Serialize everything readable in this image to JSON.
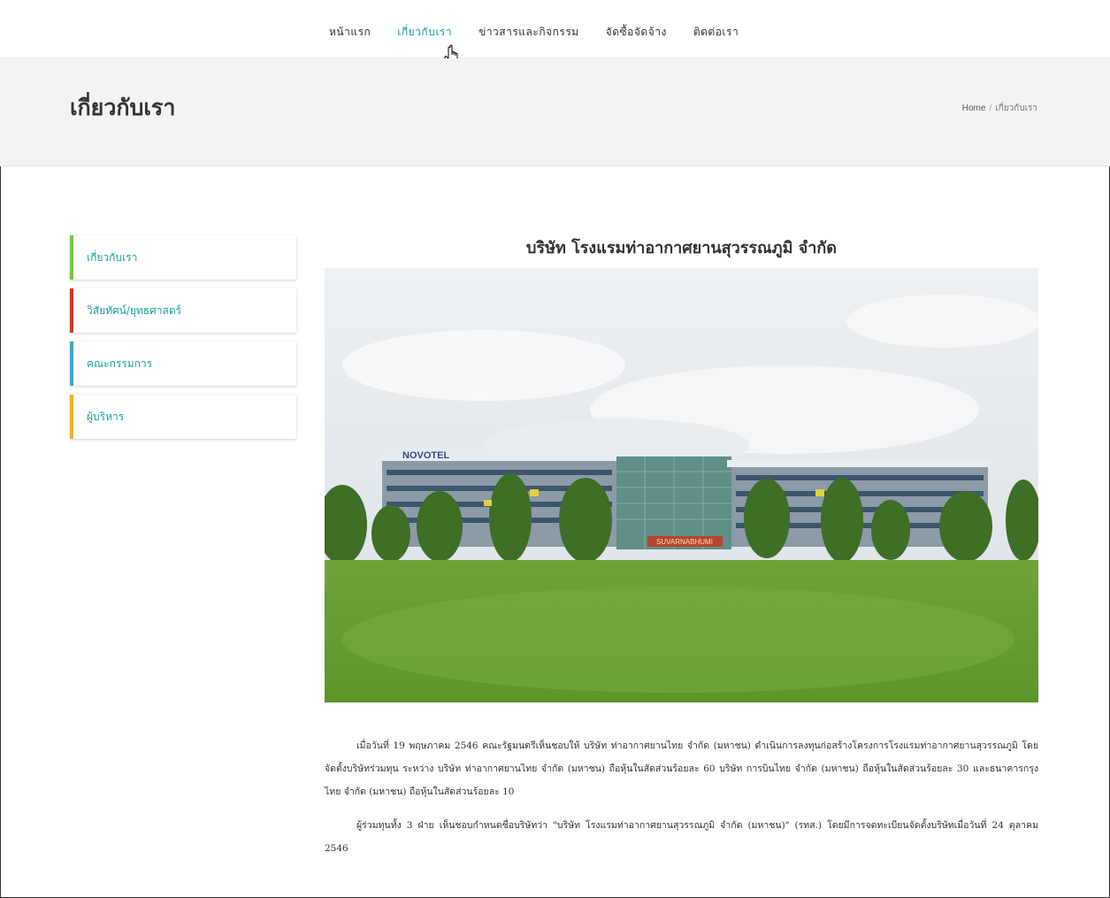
{
  "nav": {
    "items": [
      {
        "label": "หน้าแรก"
      },
      {
        "label": "เกี่ยวกับเรา"
      },
      {
        "label": "ข่าวสารและกิจกรรม"
      },
      {
        "label": "จัดซื้อจัดจ้าง"
      },
      {
        "label": "ติดต่อเรา"
      }
    ],
    "active_index": 1
  },
  "banner": {
    "title": "เกี่ยวกับเรา",
    "breadcrumb_home": "Home",
    "breadcrumb_separator": "/",
    "breadcrumb_current": "เกี่ยวกับเรา"
  },
  "sidebar": {
    "items": [
      {
        "label": "เกี่ยวกับเรา",
        "accent": "#7cc242"
      },
      {
        "label": "วิสัยทัศน์/ยุทธศาสตร์",
        "accent": "#d2382a"
      },
      {
        "label": "คณะกรรมการ",
        "accent": "#3fa7c9"
      },
      {
        "label": "ผู้บริหาร",
        "accent": "#f2b12a"
      }
    ]
  },
  "content": {
    "heading": "บริษัท โรงแรมท่าอากาศยานสุวรรณภูมิ จำกัด",
    "photo_sign_1": "NOVOTEL",
    "photo_sign_2": "SUVARNABHUMI",
    "paragraph_1": "เมื่อวันที่ 19 พฤษภาคม 2546 คณะรัฐมนตรีเห็นชอบให้ บริษัท ท่าอากาศยานไทย จำกัด (มหาชน) ดำเนินการลงทุนก่อสร้างโครงการโรงแรมท่าอากาศยานสุวรรณภูมิ โดยจัดตั้งบริษัทร่วมทุน ระหว่าง บริษัท ท่าอากาศยานไทย จำกัด (มหาชน) ถือหุ้นในสัดส่วนร้อยละ 60 บริษัท การบินไทย จำกัด (มหาชน) ถือหุ้นในสัดส่วนร้อยละ 30 และธนาคารกรุงไทย จำกัด (มหาชน) ถือหุ้นในสัดส่วนร้อยละ 10",
    "paragraph_2": "ผู้ร่วมทุนทั้ง 3 ฝ่าย เห็นชอบกำหนดชื่อบริษัทว่า \"บริษัท โรงแรมท่าอากาศยานสุวรรณภูมิ จำกัด (มหาชน)\" (รทส.) โดยมีการจดทะเบียนจัดตั้งบริษัทเมื่อวันที่ 24 ตุลาคม 2546"
  },
  "colors": {
    "accent_teal": "#1aa39c",
    "banner_bg": "#f3f3f3"
  }
}
